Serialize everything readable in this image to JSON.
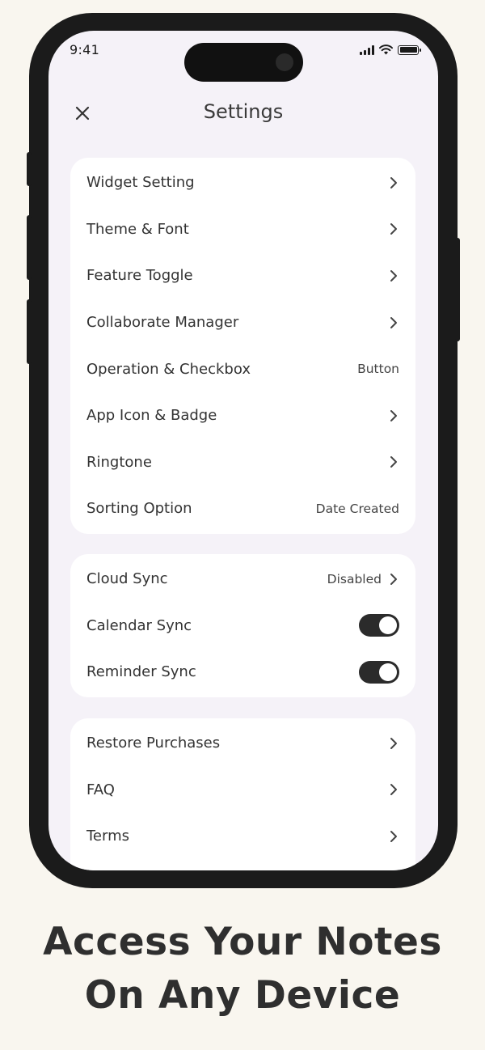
{
  "status_bar": {
    "time": "9:41"
  },
  "header": {
    "title": "Settings"
  },
  "groups": [
    {
      "items": [
        {
          "label": "Widget Setting",
          "value": "",
          "chevron": true
        },
        {
          "label": "Theme & Font",
          "value": "",
          "chevron": true
        },
        {
          "label": "Feature Toggle",
          "value": "",
          "chevron": true
        },
        {
          "label": "Collaborate Manager",
          "value": "",
          "chevron": true
        },
        {
          "label": "Operation & Checkbox",
          "value": "Button",
          "chevron": false
        },
        {
          "label": "App Icon & Badge",
          "value": "",
          "chevron": true
        },
        {
          "label": "Ringtone",
          "value": "",
          "chevron": true
        },
        {
          "label": "Sorting Option",
          "value": "Date Created",
          "chevron": false
        }
      ]
    },
    {
      "items": [
        {
          "label": "Cloud Sync",
          "value": "Disabled",
          "chevron": true
        },
        {
          "label": "Calendar Sync",
          "toggle": true,
          "on": true
        },
        {
          "label": "Reminder Sync",
          "toggle": true,
          "on": true
        }
      ]
    },
    {
      "items": [
        {
          "label": "Restore Purchases",
          "value": "",
          "chevron": true
        },
        {
          "label": "FAQ",
          "value": "",
          "chevron": true
        },
        {
          "label": "Terms",
          "value": "",
          "chevron": true
        }
      ]
    }
  ],
  "caption": {
    "line1": "Access Your Notes",
    "line2": "On Any Device"
  },
  "colors": {
    "background": "#f9f6ef",
    "screen": "#f5f2f8",
    "card": "#ffffff",
    "toggle_on": "#2b2b2b"
  }
}
